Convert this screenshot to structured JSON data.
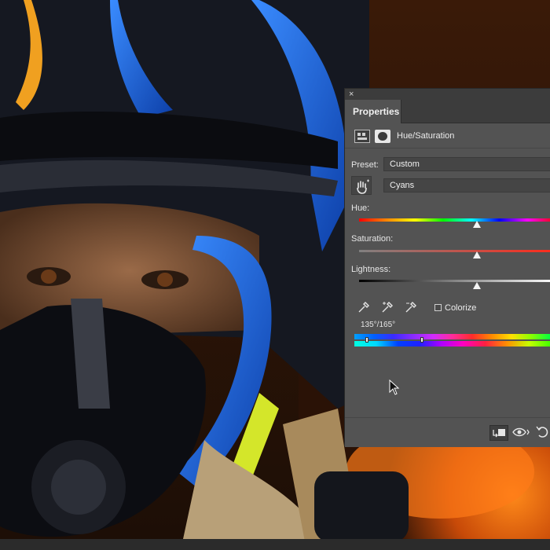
{
  "panel": {
    "close_glyph": "×",
    "tab_label": "Properties",
    "adjustment_type": "Hue/Saturation",
    "preset_label": "Preset:",
    "preset_value": "Custom",
    "channel_value": "Cyans",
    "hue_label": "Hue:",
    "saturation_label": "Saturation:",
    "lightness_label": "Lightness:",
    "colorize_label": "Colorize",
    "range_readout": "135°/165°",
    "hue_value_fraction": 0.6,
    "saturation_value_fraction": 0.6,
    "lightness_value_fraction": 0.6
  },
  "icons": {
    "adjustment_icon": "hue-saturation-adjustment-icon",
    "mask_icon": "layer-mask-icon",
    "targeted_adjustment_tool": "hand-tool-icon",
    "eyedroppers": [
      "eyedropper-icon",
      "eyedropper-add-icon",
      "eyedropper-subtract-icon"
    ],
    "footer": [
      "clip-to-layer-icon",
      "view-previous-state-icon",
      "reset-icon"
    ],
    "cursor": "arrow-cursor-icon"
  },
  "colors": {
    "panel_bg": "#535353",
    "panel_header": "#3c3c3c",
    "helmet_blue": "#1f6fe0",
    "fire_orange": "#ff6a10"
  }
}
